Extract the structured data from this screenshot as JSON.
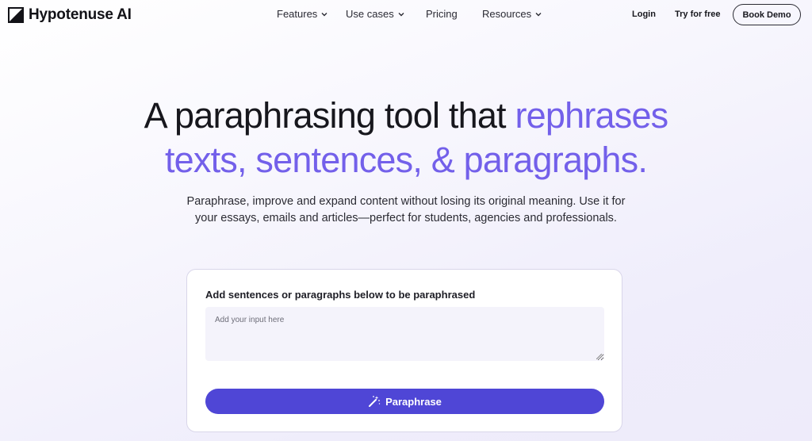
{
  "brand": {
    "name": "Hypotenuse AI",
    "icon": "logo-mark-icon"
  },
  "nav": {
    "items": [
      {
        "label": "Features",
        "dropdown": true
      },
      {
        "label": "Use cases",
        "dropdown": true
      },
      {
        "label": "Pricing",
        "dropdown": false
      },
      {
        "label": "Resources",
        "dropdown": true
      }
    ],
    "login": "Login",
    "try_free": "Try for free",
    "book_demo": "Book Demo"
  },
  "hero": {
    "headline_part1": "A paraphrasing tool that ",
    "headline_accent_1": "rephrases",
    "headline_accent_2": "texts, sentences, & paragraphs.",
    "subtext": "Paraphrase, improve and expand content without losing its original meaning.  Use it for your essays, emails and articles—perfect for students, agencies and professionals."
  },
  "tool": {
    "label": "Add sentences or paragraphs below to be paraphrased",
    "input_placeholder": "Add your input here",
    "input_value": "",
    "button_label": "Paraphrase",
    "button_icon": "magic-wand-icon"
  },
  "colors": {
    "accent": "#7360ea",
    "button": "#4f46d6",
    "text": "#17171d"
  }
}
